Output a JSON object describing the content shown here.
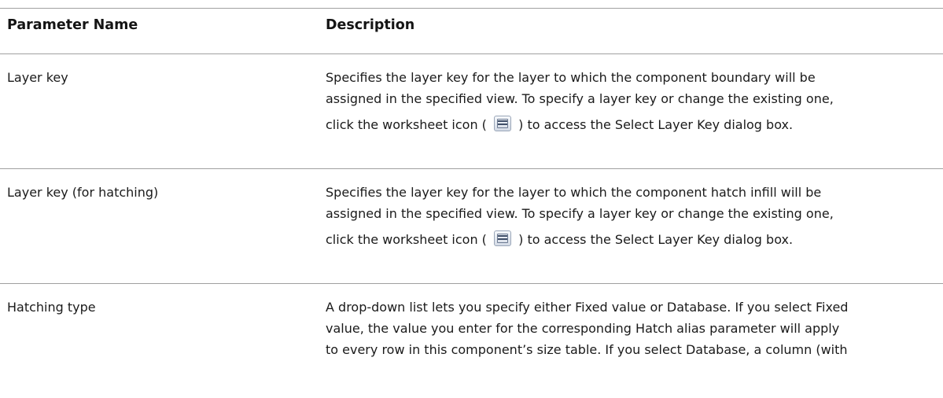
{
  "table": {
    "headers": {
      "name": "Parameter Name",
      "description": "Description"
    },
    "rows": [
      {
        "name": "Layer key",
        "desc_line1": "Specifies the layer key for the layer to which the component boundary will be",
        "desc_line2": "assigned in the specified view. To specify a layer key or change the existing one,",
        "desc_line3_pre": "click the worksheet icon (",
        "desc_line3_post": ") to access the Select Layer Key dialog box."
      },
      {
        "name": "Layer key (for hatching)",
        "desc_line1": "Specifies the layer key for the layer to which the component hatch infill will be",
        "desc_line2": "assigned in the specified view. To specify a layer key or change the existing one,",
        "desc_line3_pre": "click the worksheet icon (",
        "desc_line3_post": ") to access the Select Layer Key dialog box."
      },
      {
        "name": "Hatching type",
        "desc_line1": "A drop-down list lets you specify either Fixed value or Database. If you select Fixed",
        "desc_line2": "value, the value you enter for the corresponding Hatch alias parameter will apply",
        "desc_line3": "to every row in this component’s size table. If you select Database, a column (with"
      }
    ]
  },
  "icons": {
    "worksheet": "worksheet-icon"
  }
}
